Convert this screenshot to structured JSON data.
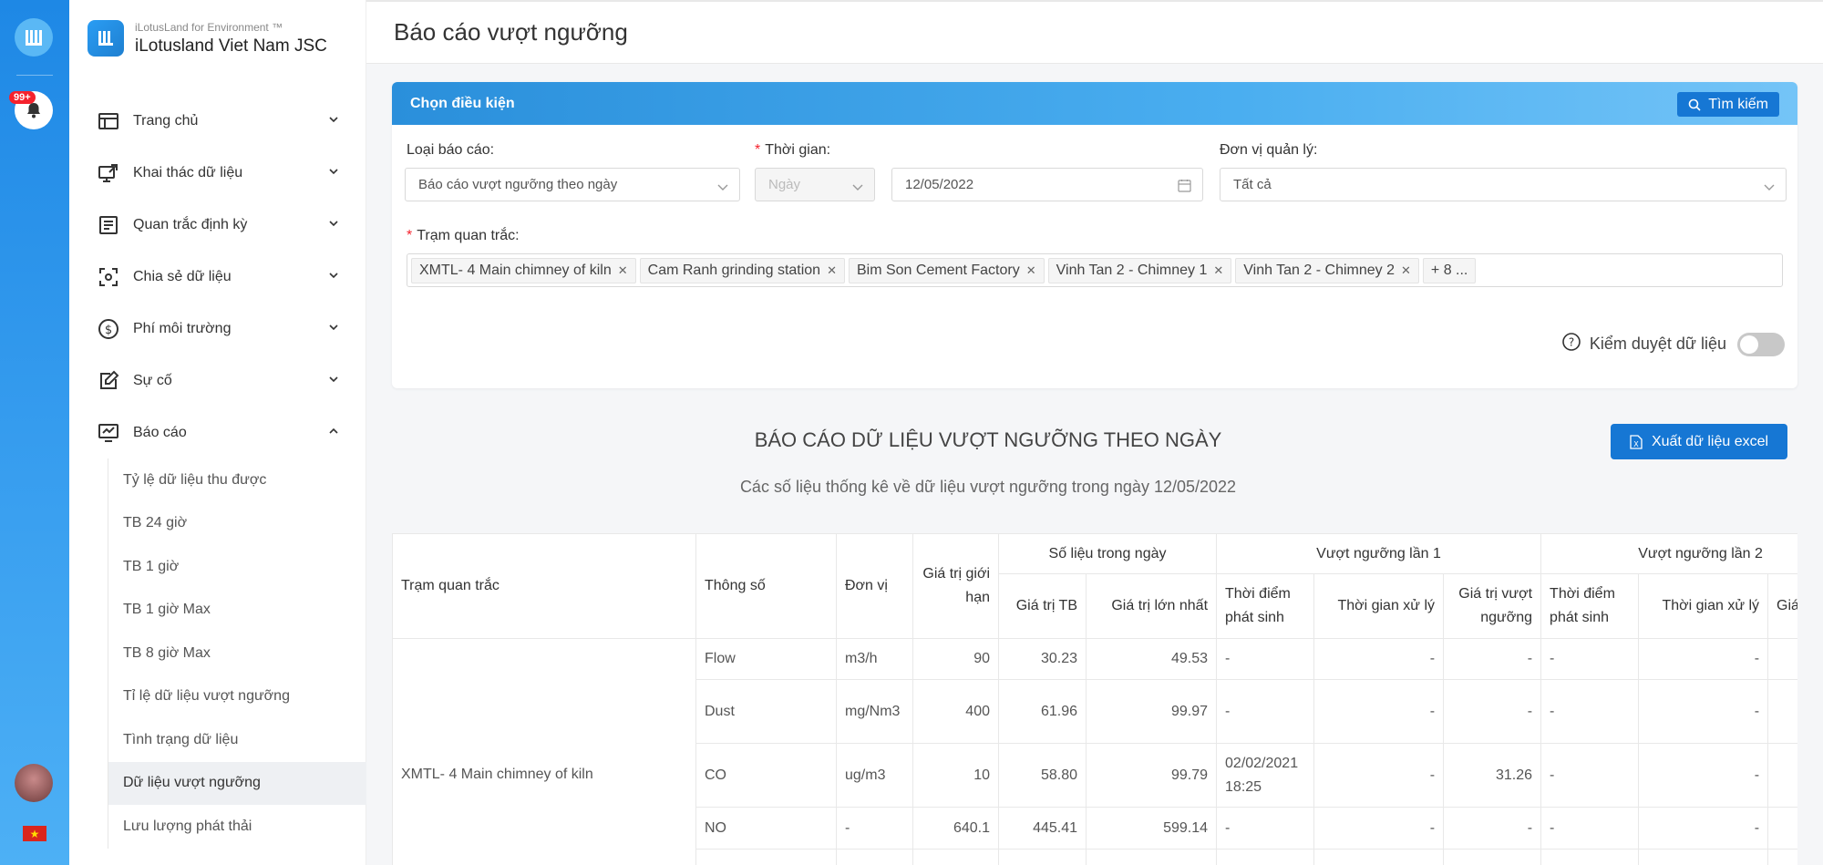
{
  "rail": {
    "badge": "99+"
  },
  "brand": {
    "sub": "iLotusLand for Environment ™",
    "name": "iLotusland Viet Nam JSC"
  },
  "menu": [
    {
      "label": "Trang chủ"
    },
    {
      "label": "Khai thác dữ liệu"
    },
    {
      "label": "Quan trắc định kỳ"
    },
    {
      "label": "Chia sẻ dữ liệu"
    },
    {
      "label": "Phí môi trường"
    },
    {
      "label": "Sự cố"
    },
    {
      "label": "Báo cáo"
    }
  ],
  "submenu": [
    "Tỷ lệ dữ liệu thu được",
    "TB 24 giờ",
    "TB 1 giờ",
    "TB 1 giờ Max",
    "TB 8 giờ Max",
    "Tỉ lệ dữ liệu vượt ngưỡng",
    "Tình trạng dữ liệu",
    "Dữ liệu vượt ngưỡng",
    "Lưu lượng phát thải"
  ],
  "page": {
    "title": "Báo cáo vượt ngưỡng"
  },
  "filter": {
    "header": "Chọn điều kiện",
    "search_label": "Tìm kiếm",
    "report_type_label": "Loại báo cáo:",
    "report_type_value": "Báo cáo vượt ngưỡng theo ngày",
    "time_label": "Thời gian:",
    "time_unit_value": "Ngày",
    "date_value": "12/05/2022",
    "unit_label": "Đơn vị quản lý:",
    "unit_value": "Tất cả",
    "stations_label": "Trạm quan trắc:",
    "stations": [
      "XMTL- 4 Main chimney of kiln",
      "Cam Ranh grinding station",
      "Bim Son Cement Factory",
      "Vinh Tan 2 - Chimney 1",
      "Vinh Tan 2 - Chimney 2"
    ],
    "more_stations": "+ 8 ...",
    "moderation_label": "Kiểm duyệt dữ liệu"
  },
  "report": {
    "title": "BÁO CÁO DỮ LIỆU VƯỢT NGƯỠNG THEO NGÀY",
    "subtitle": "Các số liệu thống kê về dữ liệu vượt ngưỡng trong ngày 12/05/2022",
    "export_label": "Xuất dữ liệu excel"
  },
  "table": {
    "h_station": "Trạm quan trắc",
    "h_param": "Thông số",
    "h_unit": "Đơn vị",
    "h_limit": "Giá trị giới hạn",
    "h_day": "Số liệu trong ngày",
    "h_avg": "Giá trị TB",
    "h_max": "Giá trị lớn nhất",
    "h_exceed1": "Vượt ngưỡng lần 1",
    "h_exceed2": "Vượt ngưỡng lần 2",
    "h_occur": "Thời điểm phát sinh",
    "h_process": "Thời gian xử lý",
    "h_exceed_val": "Giá trị vượt ngưỡng",
    "h_exceed_val_short": "Giá",
    "station_name": "XMTL- 4 Main chimney of kiln",
    "rows": [
      {
        "param": "Flow",
        "unit": "m3/h",
        "limit": "90",
        "avg": "30.23",
        "max": "49.53",
        "t1": "-",
        "p1": "-",
        "v1": "-",
        "t2": "-",
        "p2": "-"
      },
      {
        "param": "Dust",
        "unit": "mg/Nm3",
        "limit": "400",
        "avg": "61.96",
        "max": "99.97",
        "t1": "-",
        "p1": "-",
        "v1": "-",
        "t2": "-",
        "p2": "-"
      },
      {
        "param": "CO",
        "unit": "ug/m3",
        "limit": "10",
        "avg": "58.80",
        "max": "99.79",
        "t1": "02/02/2021 18:25",
        "p1": "-",
        "v1": "31.26",
        "t2": "-",
        "p2": "-"
      },
      {
        "param": "NO",
        "unit": "-",
        "limit": "640.1",
        "avg": "445.41",
        "max": "599.14",
        "t1": "-",
        "p1": "-",
        "v1": "-",
        "t2": "-",
        "p2": "-"
      },
      {
        "param": "",
        "unit": "",
        "limit": "",
        "avg": "",
        "max": "",
        "t1": "",
        "p1": "",
        "v1": "",
        "t2": "",
        "p2": ""
      }
    ]
  }
}
